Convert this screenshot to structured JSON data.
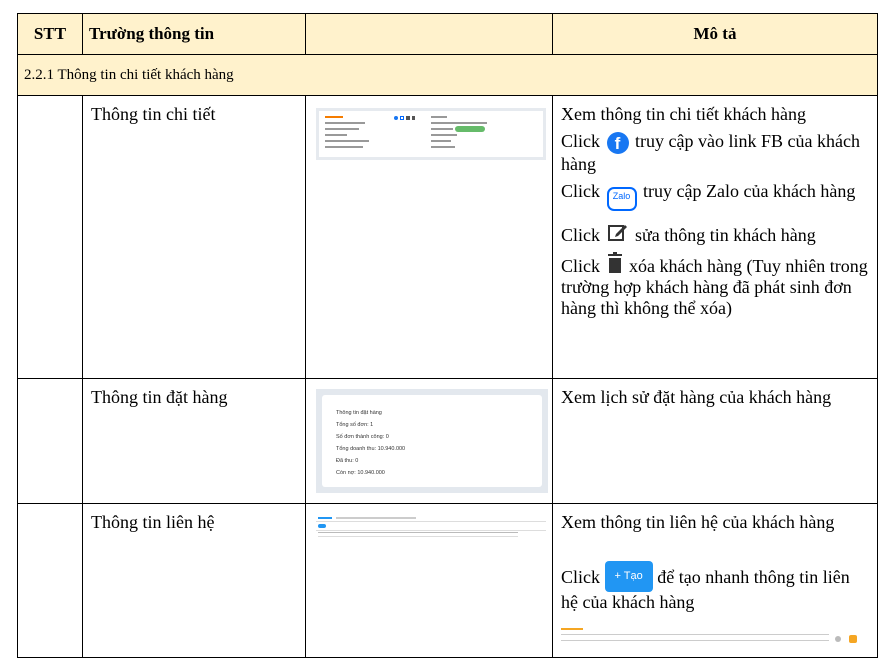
{
  "table": {
    "headers": {
      "stt": "STT",
      "field": "Trường  thông tin",
      "image": "",
      "desc": "Mô tả"
    },
    "section": "2.2.1 Thông tin chi tiết khách hàng",
    "rows": [
      {
        "field": "Thông tin chi tiết",
        "desc": {
          "line1": "Xem thông tin chi tiết khách hàng",
          "fb_prefix": "Click",
          "fb_text": " truy cập vào link FB của khách hàng",
          "zalo_prefix": "Click",
          "zalo_text": " truy cập Zalo của khách hàng",
          "edit_prefix": "Click",
          "edit_text": " sửa thông tin khách hàng",
          "del_prefix": "Click",
          "del_text": " xóa khách hàng (Tuy nhiên trong trường hợp khách hàng đã phát sinh đơn hàng thì không thể xóa)"
        }
      },
      {
        "field": "Thông tin đặt hàng",
        "desc": {
          "line1": "Xem lịch sử đặt hàng của khách hàng"
        },
        "thumb": {
          "title": "Thông tin đặt hàng",
          "lines": [
            "Tổng số đơn: 1",
            "Số đơn thành công: 0",
            "Tổng doanh thu: 10.940.000",
            "Đã thu: 0",
            "Còn nợ: 10.940.000"
          ]
        }
      },
      {
        "field": "Thông tin liên hệ",
        "desc": {
          "line1": "Xem thông tin liên hệ của khách hàng",
          "create_prefix": "Click",
          "create_text": " để tạo nhanh thông tin liên hệ của khách hàng",
          "create_button": "+ Tạo"
        }
      }
    ]
  },
  "icons": {
    "facebook": "facebook-icon",
    "zalo": "zalo-icon",
    "edit": "edit-icon",
    "trash": "trash-icon"
  },
  "icon_labels": {
    "facebook": "f",
    "zalo": "Zalo"
  },
  "colors": {
    "header_bg": "#fff2cc",
    "facebook": "#1877f2",
    "zalo": "#0068ff",
    "button": "#2196f3"
  }
}
